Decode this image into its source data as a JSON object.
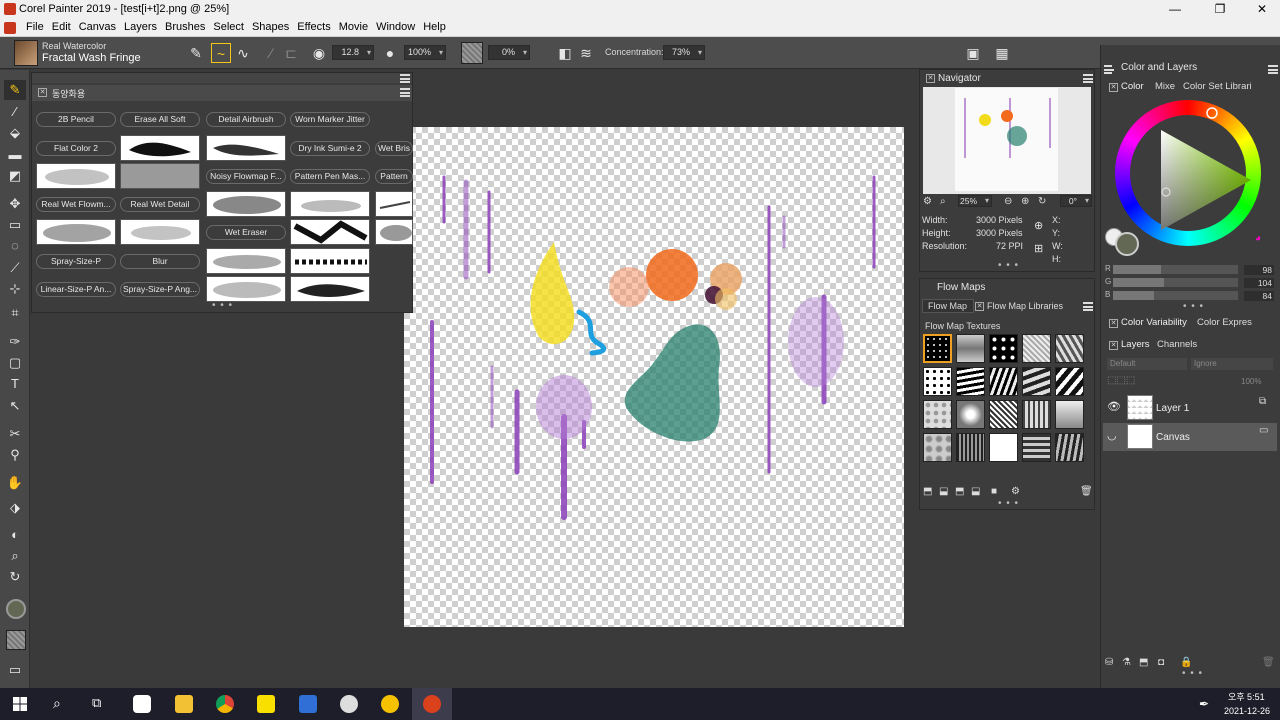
{
  "window": {
    "title": "Corel Painter 2019 - [test[i+t]2.png @ 25%]",
    "minimize": "—",
    "restore": "❐",
    "close": "✕"
  },
  "menu": [
    "File",
    "Edit",
    "Canvas",
    "Layers",
    "Brushes",
    "Select",
    "Shapes",
    "Effects",
    "Movie",
    "Window",
    "Help"
  ],
  "propbar": {
    "brush_category": "Real Watercolor",
    "brush_variant": "Fractal Wash Fringe",
    "size": "12.8",
    "opacity": "100%",
    "grain": "0%",
    "concentration_label": "Concentration:",
    "concentration": "73%"
  },
  "brush_library": {
    "tab": "동양화용",
    "buttons": [
      "2B Pencil",
      "Erase All Soft",
      "Detail Airbrush",
      "Worn Marker Jitter",
      "Flat Color 2",
      "Dry Ink Sumi-e 2",
      "Wet Bris",
      "Noisy Flowmap F...",
      "Pattern Pen Mas...",
      "Pattern",
      "Real Wet Flowm...",
      "Real Wet Detail",
      "Wet Eraser",
      "Spray-Size-P",
      "Blur",
      "Linear-Size-P An...",
      "Spray-Size-P Ang..."
    ],
    "more": "• • •"
  },
  "navigator": {
    "title": "Navigator",
    "zoom": "25%",
    "rotation": "0°",
    "width_label": "Width:",
    "width_value": "3000 Pixels",
    "height_label": "Height:",
    "height_value": "3000 Pixels",
    "resolution_label": "Resolution:",
    "resolution_value": "72 PPI",
    "x_label": "X:",
    "y_label": "Y:",
    "w_label": "W:",
    "h_label": "H:",
    "more": "• • •"
  },
  "flow_maps": {
    "title": "Flow Maps",
    "tab1": "Flow Map",
    "tab2": "Flow Map Libraries",
    "section": "Flow Map Textures",
    "more": "• • •"
  },
  "color_layers": {
    "title": "Color and Layers",
    "tab_color": "Color",
    "tab_mixer": "Mixe",
    "tab_colorset": "Color Set Librari",
    "r_label": "R",
    "r_value": "98",
    "g_label": "G",
    "g_value": "104",
    "b_label": "B",
    "b_value": "84",
    "variability_tab": "Color Variability",
    "expression_tab": "Color Expres",
    "layers_tab": "Layers",
    "channels_tab": "Channels",
    "composite": "Default",
    "preserve": "Ignore",
    "opacity": "100%",
    "layers": [
      "Layer 1",
      "Canvas"
    ],
    "more": "• • •"
  },
  "taskbar": {
    "time": "오후 5:51",
    "date": "2021-12-26"
  },
  "colors": {
    "current_color": "#626854",
    "accent_active": "#f5c518"
  }
}
